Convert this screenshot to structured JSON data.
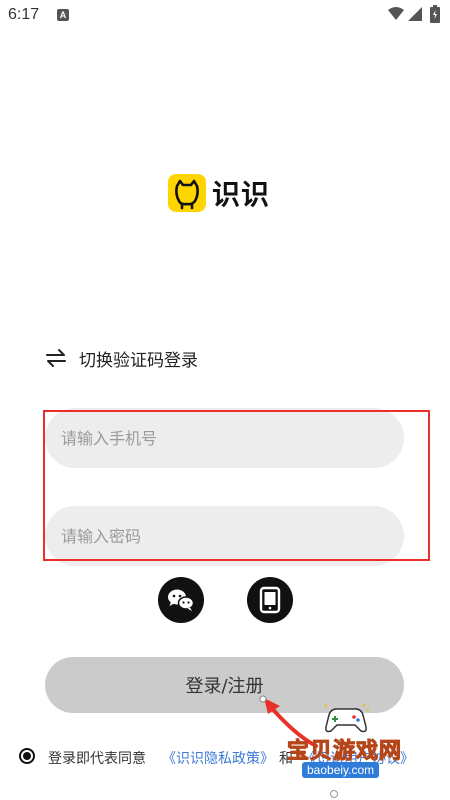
{
  "status_bar": {
    "time": "6:17",
    "notification_icon": "A"
  },
  "logo": {
    "app_name": "识识",
    "brand_color": "#FFD500"
  },
  "switch_mode": {
    "label": "切换验证码登录",
    "icon": "swap-arrows-icon"
  },
  "form": {
    "phone_placeholder": "请输入手机号",
    "password_placeholder": "请输入密码",
    "phone_value": "",
    "password_value": ""
  },
  "social_login": [
    {
      "icon": "wechat-icon"
    },
    {
      "icon": "tablet-icon"
    }
  ],
  "login_button": {
    "label": "登录/注册"
  },
  "agreement": {
    "checked": true,
    "prefix": "登录即代表同意",
    "privacy_policy": "《识识隐私政策》",
    "conjunction": "和",
    "user_agreement": "《识识用户协议》"
  },
  "watermark": {
    "title": "宝贝游戏网",
    "url": "baobeiy.com"
  },
  "colors": {
    "annotation_red": "#E8312A",
    "link_blue": "#3E7BD6",
    "input_bg": "#EDEDED",
    "button_bg": "#CBCBCB"
  }
}
